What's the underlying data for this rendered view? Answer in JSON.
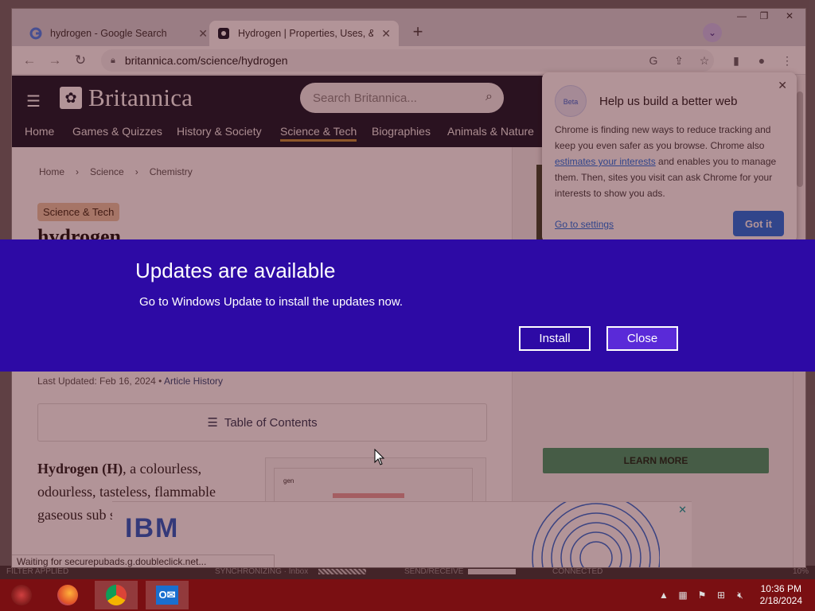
{
  "outlook_bg": {
    "statusbar": {
      "filter": "FILTER APPLIED",
      "sync": "SYNCHRONIZING · Inbox",
      "sendrecv": "SEND/RECEIVE",
      "connected": "CONNECTED",
      "zoom": "10%"
    }
  },
  "chrome": {
    "tabs": [
      {
        "title": "hydrogen - Google Search",
        "favicon": "google-icon"
      },
      {
        "title": "Hydrogen | Properties, Uses, & Fa",
        "favicon": "britannica-icon"
      }
    ],
    "address": "britannica.com/science/hydrogen",
    "status_text": "Waiting for securepubads.g.doubleclick.net..."
  },
  "britannica": {
    "logo_text": "Britannica",
    "search_placeholder": "Search Britannica...",
    "nav": [
      "Home",
      "Games & Quizzes",
      "History & Society",
      "Science & Tech",
      "Biographies",
      "Animals & Nature"
    ],
    "active_nav": "Science & Tech",
    "breadcrumb": [
      "Home",
      "Science",
      "Chemistry"
    ],
    "category": "Science & Tech",
    "title": "hydrogen",
    "last_updated": "Last Updated: Feb 16, 2024",
    "article_history": "Article History",
    "toc_label": "Table of Contents",
    "lede_bold": "Hydrogen (H)",
    "lede_text": ", a colourless, odourless, tasteless, flammable gaseous sub simplest me",
    "figure_label": "gen",
    "learn_more": "LEARN MORE",
    "ad_brand": "IBM"
  },
  "privacy_popup": {
    "badge": "Beta",
    "title": "Help us build a better web",
    "body_1": "Chrome is finding new ways to reduce tracking and keep you even safer as you browse. Chrome also ",
    "body_link": "estimates your interests",
    "body_2": " and enables you to manage them. Then, sites you visit can ask Chrome for your interests to show you ads.",
    "settings_link": "Go to settings",
    "got_it": "Got it"
  },
  "update_banner": {
    "title": "Updates are available",
    "message": "Go to Windows Update to install the updates now.",
    "install": "Install",
    "close": "Close"
  },
  "taskbar": {
    "apps": [
      "firefox-icon",
      "chrome-icon",
      "outlook-icon"
    ],
    "time": "10:36 PM",
    "date": "2/18/2024"
  },
  "colors": {
    "update_bg": "#2d0aa5",
    "britannica_header": "#0e1a2b",
    "taskbar": "#7a0f12"
  }
}
